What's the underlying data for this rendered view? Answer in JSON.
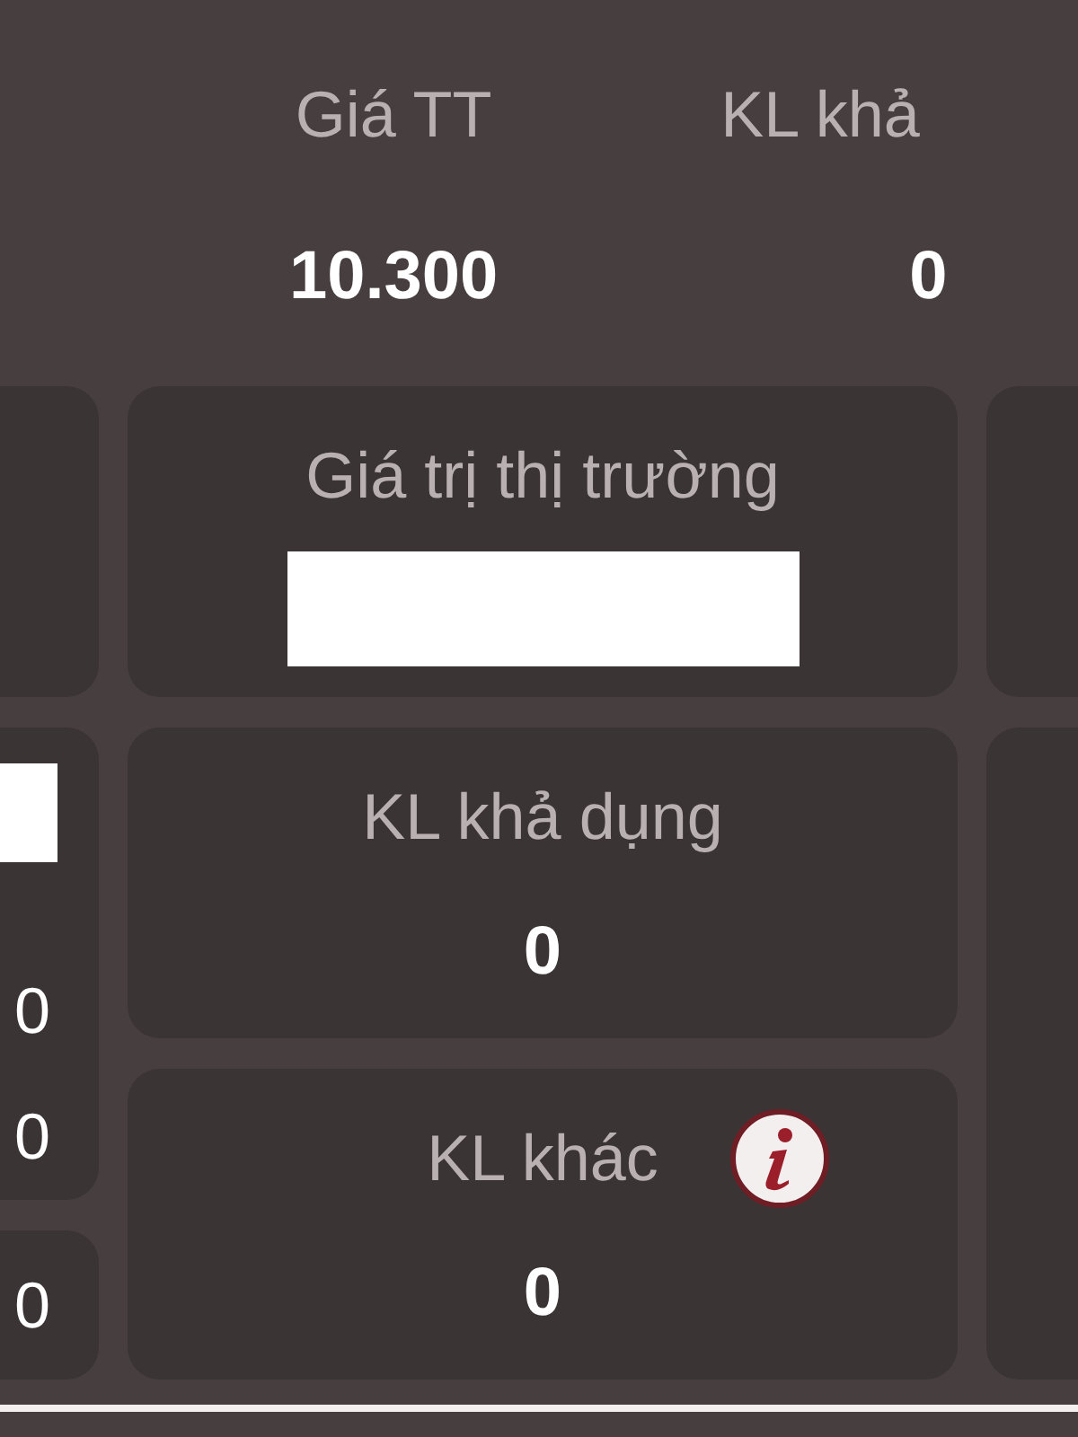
{
  "header": [
    {
      "label": "Giá TT",
      "value": "10.300"
    },
    {
      "label": "KL khả",
      "value": "0"
    }
  ],
  "center_cards": [
    {
      "label": "Giá trị thị trường",
      "kind": "redacted",
      "info": false
    },
    {
      "label": "KL khả dụng",
      "kind": "text",
      "value": "0",
      "info": false
    },
    {
      "label": "KL khác",
      "kind": "text",
      "value": "0",
      "info": true
    }
  ],
  "left_cards": [
    {
      "rows": [
        {
          "kind": "redacted"
        },
        {
          "kind": "text",
          "value": "0"
        },
        {
          "kind": "text",
          "value": "0"
        }
      ]
    },
    {
      "rows": [
        {
          "kind": "text",
          "value": "0"
        }
      ]
    }
  ]
}
